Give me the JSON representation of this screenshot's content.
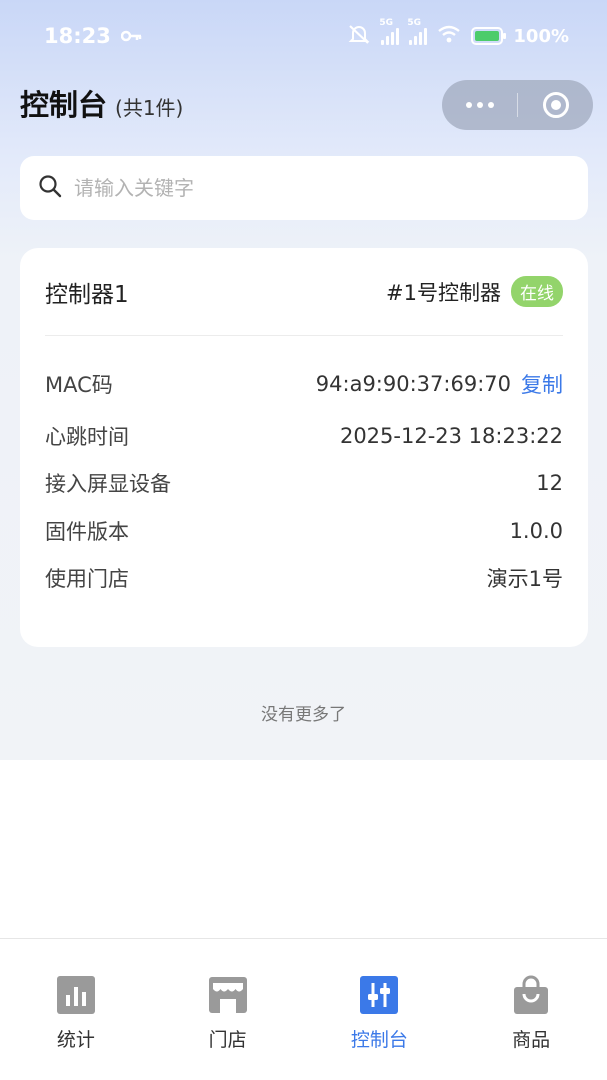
{
  "status_bar": {
    "time": "18:23",
    "network1": "5G",
    "network2": "5G",
    "battery": "100%"
  },
  "header": {
    "title": "控制台",
    "count": "(共1件)"
  },
  "search": {
    "placeholder": "请输入关键字"
  },
  "controllers": [
    {
      "name": "控制器1",
      "label": "#1号控制器",
      "status": "在线",
      "status_color": "#93d46b",
      "fields": [
        {
          "key": "MAC码",
          "value": "94:a9:90:37:69:70",
          "action": "复制"
        },
        {
          "key": "心跳时间",
          "value": "2025-12-23 18:23:22"
        },
        {
          "key": "接入屏显设备",
          "value": "12"
        },
        {
          "key": "固件版本",
          "value": "1.0.0"
        },
        {
          "key": "使用门店",
          "value": "演示1号"
        }
      ]
    }
  ],
  "list_footer": "没有更多了",
  "tabbar": {
    "accent": "#3b79e8",
    "items": [
      {
        "label": "统计",
        "icon": "chart-icon"
      },
      {
        "label": "门店",
        "icon": "store-icon"
      },
      {
        "label": "控制台",
        "icon": "sliders-icon",
        "active": true
      },
      {
        "label": "商品",
        "icon": "bag-icon"
      }
    ]
  }
}
